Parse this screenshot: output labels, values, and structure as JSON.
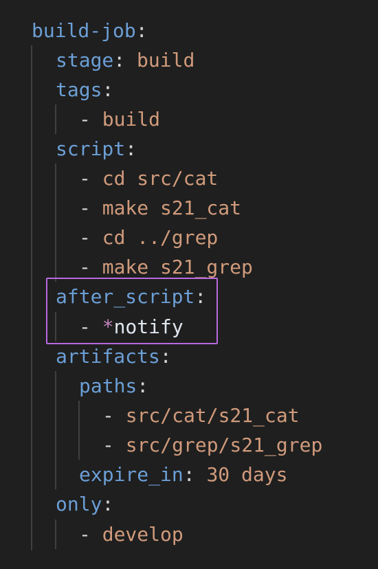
{
  "colors": {
    "background": "#1f1f1f",
    "key": "#6c9fd6",
    "value": "#d19b7c",
    "number": "#b5cea8",
    "alias_star": "#c586c0",
    "highlight_border": "#b86ae0"
  },
  "code": {
    "build_job_key": "build-job",
    "stage_key": "stage",
    "stage_value": "build",
    "tags_key": "tags",
    "tags_item_0": "build",
    "script_key": "script",
    "script_item_0": "cd src/cat",
    "script_item_1": "make s21_cat",
    "script_item_2": "cd ../grep",
    "script_item_3": "make s21_grep",
    "after_script_key": "after_script",
    "after_script_star": "*",
    "after_script_alias": "notify",
    "artifacts_key": "artifacts",
    "paths_key": "paths",
    "paths_item_0": "src/cat/s21_cat",
    "paths_item_1": "src/grep/s21_grep",
    "expire_in_key": "expire_in",
    "expire_in_number": "30",
    "expire_in_unit": " days",
    "only_key": "only",
    "only_item_0": "develop",
    "colon": ":",
    "dash": "- "
  }
}
